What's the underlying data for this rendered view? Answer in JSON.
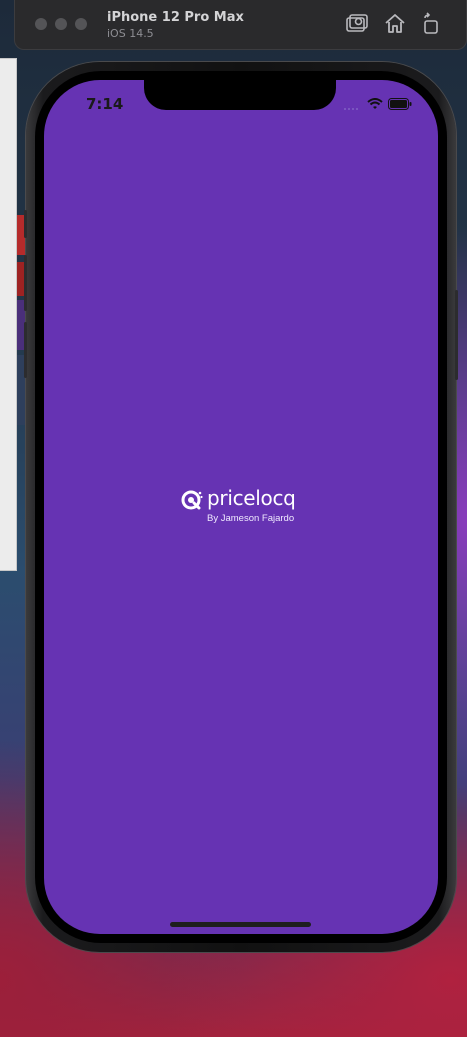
{
  "simulator": {
    "device_name": "iPhone 12 Pro Max",
    "os_version": "iOS 14.5",
    "toolbar_icons": [
      "screenshot-icon",
      "home-icon",
      "rotate-icon"
    ]
  },
  "status_bar": {
    "time": "7:14",
    "icons": [
      "signal-icon",
      "wifi-icon",
      "battery-icon"
    ]
  },
  "app": {
    "brand_name": "pricelocq",
    "byline": "By Jameson Fajardo",
    "background_color": "#6633b3",
    "logo_color": "#ffffff"
  }
}
